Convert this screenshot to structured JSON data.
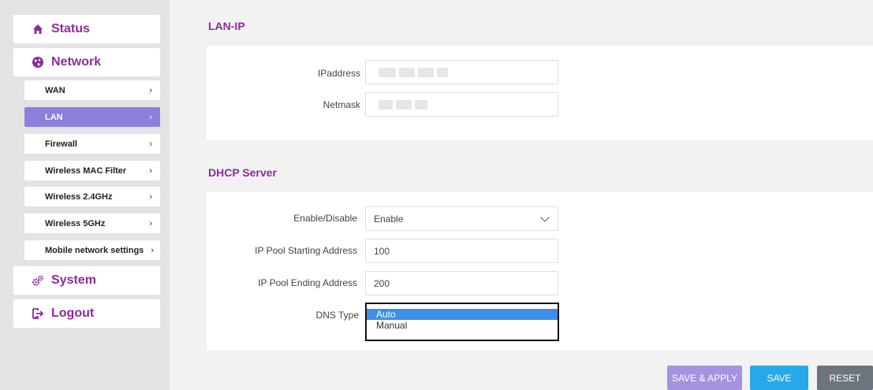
{
  "sidebar": {
    "status": {
      "label": "Status",
      "icon": "home-icon"
    },
    "network": {
      "label": "Network",
      "icon": "globe-icon"
    },
    "sub_items": [
      {
        "label": "WAN",
        "chevron": "›"
      },
      {
        "label": "LAN",
        "chevron": "›",
        "active": true
      },
      {
        "label": "Firewall",
        "chevron": "›"
      },
      {
        "label": "Wireless MAC Filter",
        "chevron": "›"
      },
      {
        "label": "Wireless 2.4GHz",
        "chevron": "›"
      },
      {
        "label": "Wireless 5GHz",
        "chevron": "›"
      },
      {
        "label": "Mobile network settings",
        "chevron": "›"
      }
    ],
    "system": {
      "label": "System",
      "icon": "gears-icon"
    },
    "logout": {
      "label": "Logout",
      "icon": "logout-icon"
    }
  },
  "lan_ip": {
    "title": "LAN-IP",
    "ipaddress_label": "IPaddress",
    "netmask_label": "Netmask"
  },
  "dhcp": {
    "title": "DHCP Server",
    "enable_label": "Enable/Disable",
    "enable_value": "Enable",
    "pool_start_label": "IP Pool Starting Address",
    "pool_start_value": "100",
    "pool_end_label": "IP Pool Ending Address",
    "pool_end_value": "200",
    "dns_type_label": "DNS Type",
    "dns_options": [
      "Auto",
      "Manual"
    ]
  },
  "buttons": {
    "save_apply": "SAVE & APPLY",
    "save": "SAVE",
    "reset": "RESET"
  },
  "colors": {
    "accent": "#8e2a9d",
    "active_item": "#8b80dc",
    "save_apply_bg": "#a593e0",
    "save_bg": "#27a8e8",
    "reset_bg": "#6c757d"
  }
}
